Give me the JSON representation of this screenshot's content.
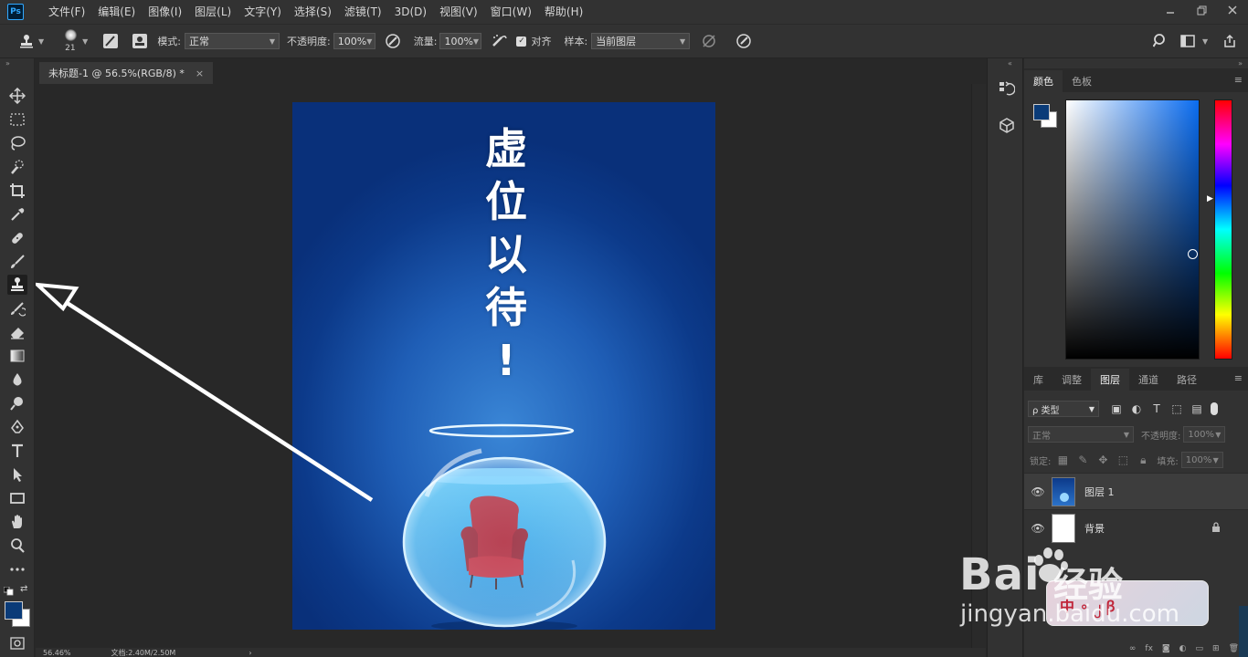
{
  "app": {
    "logo": "Ps",
    "menus": [
      "文件(F)",
      "编辑(E)",
      "图像(I)",
      "图层(L)",
      "文字(Y)",
      "选择(S)",
      "滤镜(T)",
      "3D(D)",
      "视图(V)",
      "窗口(W)",
      "帮助(H)"
    ],
    "window_controls": [
      "minimize-icon",
      "restore-icon",
      "close-icon"
    ]
  },
  "options": {
    "brush_size": "21",
    "mode_label": "模式:",
    "mode_value": "正常",
    "opacity_label": "不透明度:",
    "opacity_value": "100%",
    "flow_label": "流量:",
    "flow_value": "100%",
    "aligned_label": "对齐",
    "aligned_checked": true,
    "sample_label": "样本:",
    "sample_value": "当前图层"
  },
  "document": {
    "tab_title": "未标题-1 @ 56.5%(RGB/8) *",
    "headline": "虚\n位\n以\n待\n!",
    "background_color": "#0c3a8a"
  },
  "status": {
    "zoom": "56.46%",
    "doc_size": "文档:2.40M/2.50M"
  },
  "tools": {
    "active": "clone-stamp-tool",
    "list": [
      "move-tool",
      "marquee-tool",
      "lasso-tool",
      "quick-select-tool",
      "crop-tool",
      "eyedropper-tool",
      "healing-brush-tool",
      "brush-tool",
      "clone-stamp-tool",
      "history-brush-tool",
      "eraser-tool",
      "gradient-tool",
      "blur-tool",
      "dodge-tool",
      "pen-tool",
      "type-tool",
      "path-select-tool",
      "rectangle-tool",
      "hand-tool",
      "zoom-tool",
      "more-tools"
    ],
    "foreground_color": "#0a3b78",
    "background_color": "#ffffff"
  },
  "color_panel": {
    "tabs": [
      "颜色",
      "色板"
    ],
    "active_tab": "颜色"
  },
  "layers_panel": {
    "tabs": [
      "库",
      "调整",
      "图层",
      "通道",
      "路径"
    ],
    "active_tab": "图层",
    "filter_label": "ρ 类型",
    "blend_mode": "正常",
    "opacity_label": "不透明度:",
    "opacity_value": "100%",
    "lock_label": "锁定:",
    "fill_label": "填充:",
    "fill_value": "100%",
    "layers": [
      {
        "name": "图层 1",
        "visible": true,
        "locked": false
      },
      {
        "name": "背景",
        "visible": true,
        "locked": true
      }
    ]
  },
  "watermark": {
    "brand": "Bai",
    "product": "经验",
    "url": "jingyan.baidu.com",
    "card_text": "中 ∘ ၂ ꞵ"
  }
}
